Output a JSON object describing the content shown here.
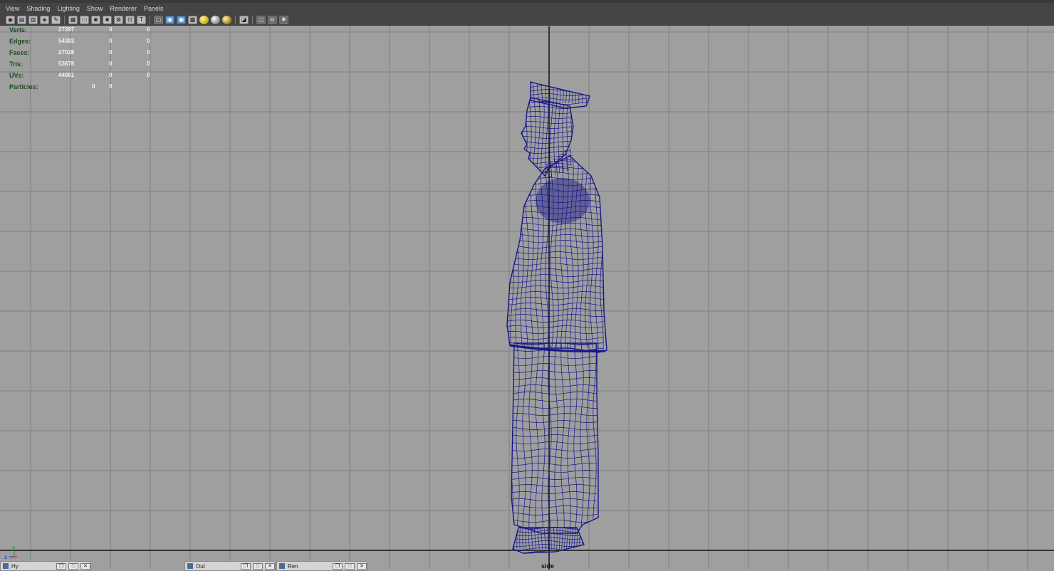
{
  "menu": {
    "items": [
      "View",
      "Shading",
      "Lighting",
      "Show",
      "Renderer",
      "Panels"
    ]
  },
  "toolbar": {
    "icons": [
      "camera-attributes-icon",
      "bookmark-icon",
      "image-plane-icon",
      "2d-pan-zoom-icon",
      "grease-pencil-icon",
      "grid-icon",
      "film-gate-icon",
      "resolution-gate-icon",
      "gate-mask-icon",
      "field-chart-icon",
      "safe-action-icon",
      "safe-title-icon",
      "wireframe-icon",
      "smooth-shade-icon",
      "wireframe-on-shaded-icon",
      "textured-icon",
      "default-light-icon",
      "all-lights-icon",
      "selected-lights-icon",
      "isolate-select-icon",
      "xray-icon",
      "xray-joints-icon",
      "xray-components-icon"
    ]
  },
  "hud": {
    "rows": [
      {
        "label": "Verts:",
        "v1": "27397",
        "v2": "0",
        "v3": "0"
      },
      {
        "label": "Edges:",
        "v1": "54383",
        "v2": "0",
        "v3": "0"
      },
      {
        "label": "Faces:",
        "v1": "27028",
        "v2": "0",
        "v3": "0"
      },
      {
        "label": "Tris:",
        "v1": "53878",
        "v2": "0",
        "v3": "0"
      },
      {
        "label": "UVs:",
        "v1": "44061",
        "v2": "0",
        "v3": "0"
      }
    ],
    "particles": {
      "label": "Particles:",
      "v1": "0",
      "v2": "0"
    }
  },
  "viewport": {
    "name": "side",
    "axis_z": "z",
    "axis_y": "y",
    "wire_color": "#16168a",
    "grid_color": "#7f7f7f",
    "bg_color": "#9f9f9f"
  },
  "panels": [
    {
      "label": "Hy"
    },
    {
      "label": "Out"
    },
    {
      "label": "Ren"
    }
  ]
}
